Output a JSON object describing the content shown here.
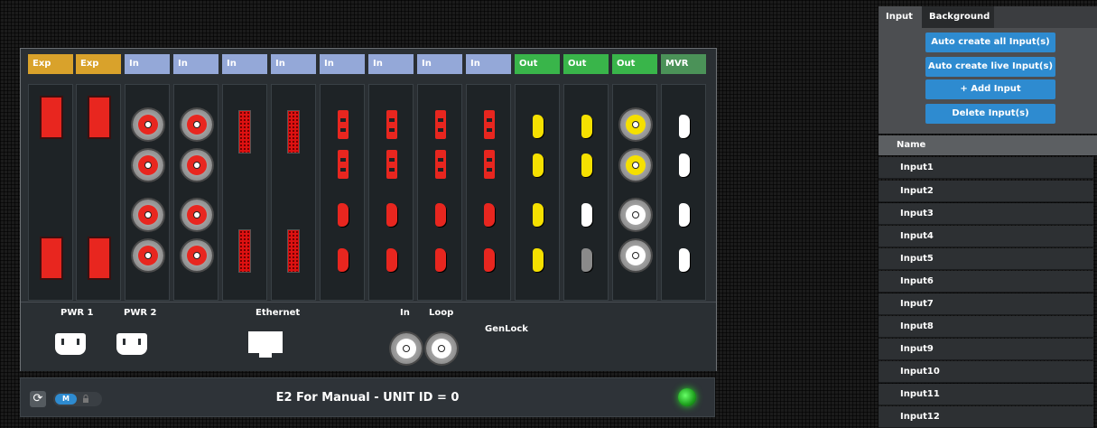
{
  "cards": [
    {
      "type": "exp",
      "label": "Exp"
    },
    {
      "type": "exp",
      "label": "Exp"
    },
    {
      "type": "in",
      "label": "In"
    },
    {
      "type": "in",
      "label": "In"
    },
    {
      "type": "in",
      "label": "In"
    },
    {
      "type": "in",
      "label": "In"
    },
    {
      "type": "in",
      "label": "In"
    },
    {
      "type": "in",
      "label": "In"
    },
    {
      "type": "in",
      "label": "In"
    },
    {
      "type": "in",
      "label": "In"
    },
    {
      "type": "out",
      "label": "Out"
    },
    {
      "type": "out",
      "label": "Out"
    },
    {
      "type": "out",
      "label": "Out"
    },
    {
      "type": "mvr",
      "label": "MVR"
    }
  ],
  "bottom": {
    "pwr1_label": "PWR 1",
    "pwr2_label": "PWR 2",
    "ethernet_label": "Ethernet",
    "genlock_in_label": "In",
    "genlock_loop_label": "Loop",
    "genlock_label": "GenLock"
  },
  "status": {
    "mode_label": "M",
    "title": "E2 For Manual - UNIT ID = 0"
  },
  "tabs": [
    {
      "label": "Input",
      "active": true
    },
    {
      "label": "Background",
      "active": false
    }
  ],
  "actions": {
    "auto_all": "Auto create all Input(s)",
    "auto_live": "Auto create live Input(s)",
    "add": "+ Add Input",
    "delete": "Delete Input(s)"
  },
  "list": {
    "header": "Name",
    "items": [
      "Input1",
      "Input2",
      "Input3",
      "Input4",
      "Input5",
      "Input6",
      "Input7",
      "Input8",
      "Input9",
      "Input10",
      "Input11",
      "Input12"
    ]
  },
  "colors": {
    "exp": "#d9a22b",
    "in": "#94a8d8",
    "out": "#39b54a",
    "mvr": "#4b9258",
    "accent": "#2e8bd0",
    "status_led": "#2cd62c"
  }
}
